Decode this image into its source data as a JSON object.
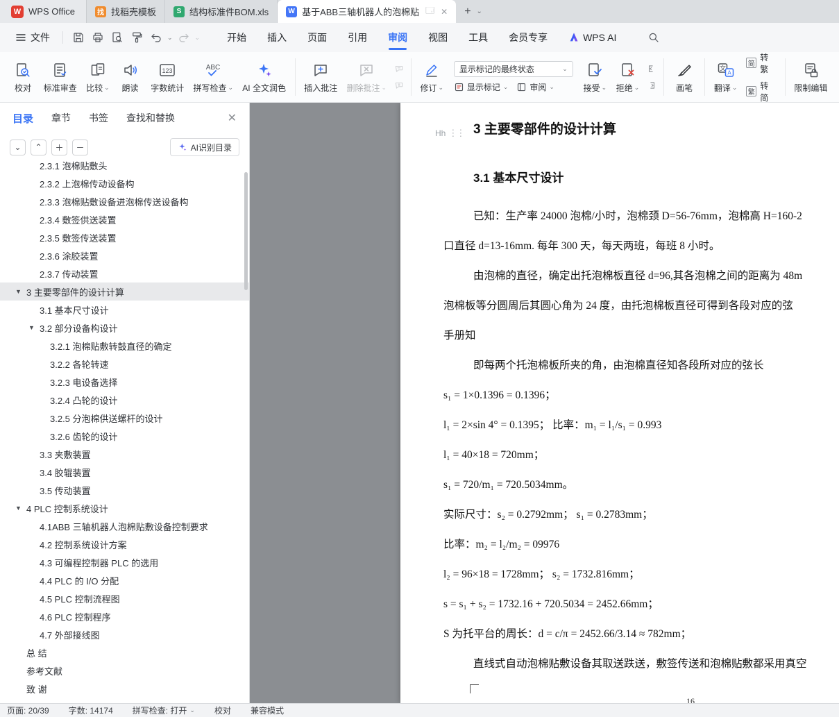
{
  "colors": {
    "accent_blue": "#3873f5",
    "wps_red": "#e23e32",
    "sheet_green": "#2fa86f",
    "doc_blue": "#4476f7",
    "reject_red": "#e0483e"
  },
  "tabbar": {
    "home": "WPS Office",
    "template": "找稻壳模板",
    "sheet": "结构标准件BOM.xls",
    "doc": "基于ABB三轴机器人的泡棉贴",
    "new_tab": "+"
  },
  "menubar": {
    "file": "文件",
    "items": [
      "开始",
      "插入",
      "页面",
      "引用",
      "审阅",
      "视图",
      "工具",
      "会员专享"
    ],
    "wps_ai": "WPS AI"
  },
  "ribbon": {
    "proofread": "校对",
    "standard_review": "标准审查",
    "compare": "比较",
    "read_aloud": "朗读",
    "word_count": "字数统计",
    "spell_check": "拼写检查",
    "ai_polish": "AI 全文润色",
    "insert_comment": "插入批注",
    "delete_comment": "删除批注",
    "track_changes": "修订",
    "markup_state": "显示标记的最终状态",
    "show_markup": "显示标记",
    "review_pane": "审阅",
    "accept": "接受",
    "reject": "拒绝",
    "ink_pen": "画笔",
    "translate": "翻译",
    "simplified_char": "简",
    "traditional_char": "繁",
    "to_traditional": "转繁",
    "to_simplified": "转简",
    "restrict_edit": "限制编辑"
  },
  "sidebar": {
    "tabs": [
      "目录",
      "章节",
      "书签",
      "查找和替换"
    ],
    "active_tab": "目录",
    "ai_button": "AI识别目录",
    "toc": [
      {
        "label": "2.3.1 泡棉贴敷头",
        "level": 2,
        "clipped": true
      },
      {
        "label": "2.3.2 上泡棉传动设备构",
        "level": 2
      },
      {
        "label": "2.3.3 泡棉贴敷设备进泡棉传送设备构",
        "level": 2
      },
      {
        "label": "2.3.4 敷签供送装置",
        "level": 2
      },
      {
        "label": "2.3.5 敷签传送装置",
        "level": 2
      },
      {
        "label": "2.3.6 涂胶装置",
        "level": 2
      },
      {
        "label": "2.3.7 传动装置",
        "level": 2
      },
      {
        "label": "3 主要零部件的设计计算",
        "level": 1,
        "arrow": true,
        "selected": true
      },
      {
        "label": "3.1 基本尺寸设计",
        "level": 2
      },
      {
        "label": "3.2 部分设备构设计",
        "level": 2,
        "arrow": true
      },
      {
        "label": "3.2.1 泡棉贴敷转鼓直径的确定",
        "level": 3
      },
      {
        "label": "3.2.2 各轮转速",
        "level": 3
      },
      {
        "label": "3.2.3 电设备选择",
        "level": 3
      },
      {
        "label": "3.2.4 凸轮的设计",
        "level": 3
      },
      {
        "label": "3.2.5 分泡棉供送螺杆的设计",
        "level": 3
      },
      {
        "label": "3.2.6 齿轮的设计",
        "level": 3
      },
      {
        "label": "3.3 夹敷装置",
        "level": 2
      },
      {
        "label": "3.4 胶辊装置",
        "level": 2
      },
      {
        "label": "3.5 传动装置",
        "level": 2
      },
      {
        "label": "4 PLC 控制系统设计",
        "level": 1,
        "arrow": true
      },
      {
        "label": "4.1ABB 三轴机器人泡棉贴敷设备控制要求",
        "level": 2
      },
      {
        "label": "4.2 控制系统设计方案",
        "level": 2
      },
      {
        "label": "4.3 可编程控制器 PLC 的选用",
        "level": 2
      },
      {
        "label": "4.4 PLC 的 I/O 分配",
        "level": 2
      },
      {
        "label": "4.5 PLC 控制流程图",
        "level": 2
      },
      {
        "label": "4.6 PLC 控制程序",
        "level": 2
      },
      {
        "label": "4.7 外部接线图",
        "level": 2
      },
      {
        "label": "总  结",
        "level": 1
      },
      {
        "label": "参考文献",
        "level": 1
      },
      {
        "label": "致  谢",
        "level": 1
      }
    ]
  },
  "document": {
    "heading_marker": "Hh",
    "title": "3 主要零部件的设计计算",
    "section_heading": "3.1 基本尺寸设计",
    "lines": [
      {
        "text": "已知：生产率 24000 泡棉/小时，泡棉颈 D=56-76mm，泡棉高 H=160-2",
        "style": "indent"
      },
      {
        "text": "口直径 d=13-16mm. 每年 300 天，每天两班，每班 8 小时。",
        "style": "flush"
      },
      {
        "text": "由泡棉的直径，确定出托泡棉板直径 d=96,其各泡棉之间的距离为 48m",
        "style": "indent"
      },
      {
        "text": "泡棉板等分圆周后其圆心角为 24 度，由托泡棉板直径可得到各段对应的弦",
        "style": "flush"
      },
      {
        "text": "手册知",
        "style": "flush"
      },
      {
        "text": "即每两个托泡棉板所夹的角，由泡棉直径知各段所对应的弦长",
        "style": "indent"
      },
      {
        "text": "s₁ = 1×0.1396 = 0.1396；",
        "style": "formula"
      },
      {
        "text": "l₁ = 2×sin 4° = 0.1395；  比率：m₁ = l₁/s₁ = 0.993",
        "style": "formula"
      },
      {
        "text": "l₁ = 40×18 = 720mm；",
        "style": "formula"
      },
      {
        "text": "s₁ = 720/m₁ = 720.5034mm。",
        "style": "formula"
      },
      {
        "text": "实际尺寸：s₂ = 0.2792mm；  s₁ = 0.2783mm；",
        "style": "formula"
      },
      {
        "text": "比率：m₂ = l₂/m₂ = 09976",
        "style": "formula"
      },
      {
        "text": "l₂ = 96×18 = 1728mm；  s₂ = 1732.816mm；",
        "style": "formula"
      },
      {
        "text": "s = s₁ + s₂ = 1732.16 + 720.5034 = 2452.66mm；",
        "style": "formula"
      },
      {
        "text": "S 为托平台的周长：d = c/π = 2452.66/3.14 ≈ 782mm；",
        "style": "formula"
      },
      {
        "text": "直线式自动泡棉贴敷设备其取送跌送，敷签传送和泡棉贴敷都采用真空",
        "style": "indent"
      }
    ],
    "page_number": "16"
  },
  "statusbar": {
    "page": "页面: 20/39",
    "words": "字数: 14174",
    "spell": "拼写检查: 打开",
    "proofread": "校对",
    "mode": "兼容模式"
  }
}
